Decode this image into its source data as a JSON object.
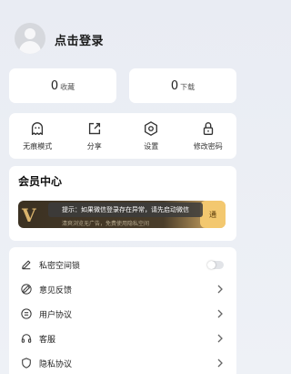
{
  "header": {
    "login_text": "点击登录"
  },
  "stats": [
    {
      "count": "0",
      "label": "收藏"
    },
    {
      "count": "0",
      "label": "下载"
    }
  ],
  "actions": [
    {
      "label": "无痕模式",
      "icon": "ghost-icon"
    },
    {
      "label": "分享",
      "icon": "share-icon"
    },
    {
      "label": "设置",
      "icon": "gear-icon"
    },
    {
      "label": "修改密码",
      "icon": "lock-icon"
    }
  ],
  "vip": {
    "title": "会员中心",
    "logo": "V",
    "subtitle": "清爽浏览无广告，免费使用隐私空间",
    "open_label": "通"
  },
  "toast": {
    "text": "提示：如果微信登录存在异常，请先启动微信"
  },
  "menu": [
    {
      "label": "私密空间锁",
      "icon": "lock-edit-icon",
      "control": "toggle",
      "toggle_on": false
    },
    {
      "label": "意见反馈",
      "icon": "edit-icon",
      "control": "chevron"
    },
    {
      "label": "用户协议",
      "icon": "document-icon",
      "control": "chevron"
    },
    {
      "label": "客服",
      "icon": "headset-icon",
      "control": "chevron"
    },
    {
      "label": "隐私协议",
      "icon": "shield-icon",
      "control": "chevron"
    }
  ]
}
